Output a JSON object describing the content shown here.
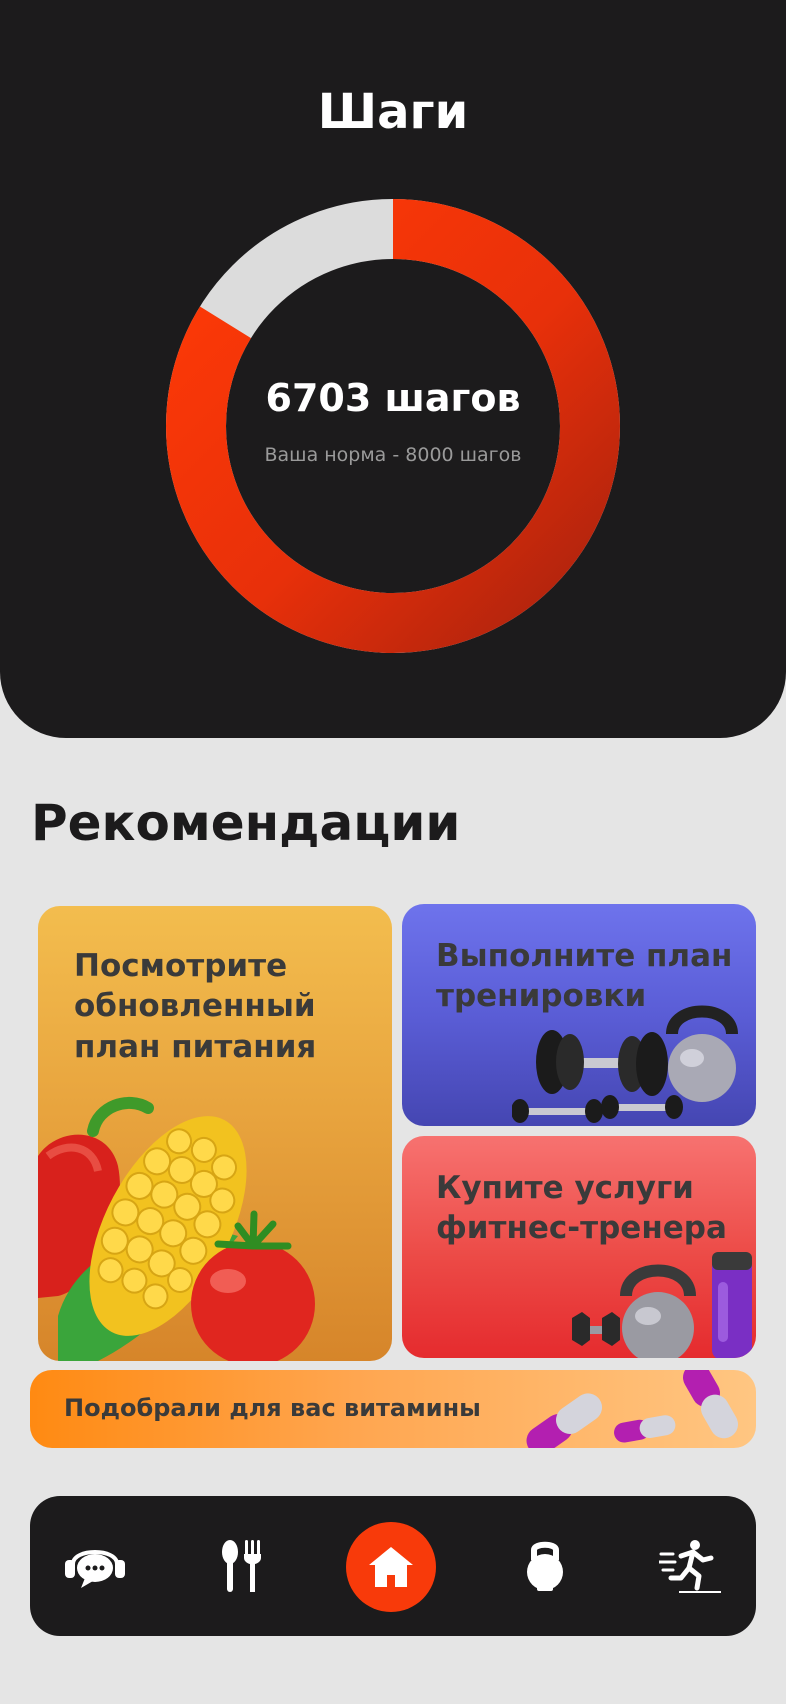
{
  "steps": {
    "title": "Шаги",
    "count_label": "6703 шагов",
    "norm_label": "Ваша норма - 8000 шагов",
    "current": 6703,
    "goal": 8000,
    "progress_color": "#f83a0a",
    "remaining_color": "#dcdcdc"
  },
  "recommendations": {
    "title": "Рекомендации",
    "cards": [
      {
        "label": "Посмотрите обновленный план питания",
        "icon": "vegetables-illustration"
      },
      {
        "label": "Выполните план тренировки",
        "icon": "dumbbells-illustration"
      },
      {
        "label": "Купите услуги фитнес-тренера",
        "icon": "kettlebell-illustration"
      },
      {
        "label": "Подобрали для вас витамины",
        "icon": "capsules-illustration"
      }
    ]
  },
  "nav": {
    "items": [
      {
        "name": "support",
        "icon": "chat-headset-icon"
      },
      {
        "name": "nutrition",
        "icon": "spoon-fork-icon"
      },
      {
        "name": "home",
        "icon": "home-icon",
        "active": true
      },
      {
        "name": "workout",
        "icon": "kettlebell-icon"
      },
      {
        "name": "activity",
        "icon": "running-man-icon"
      }
    ],
    "active_color": "#f83a0a"
  }
}
